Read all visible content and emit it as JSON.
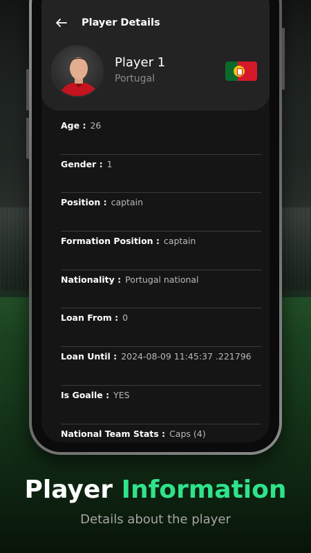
{
  "header": {
    "title": "Player Details",
    "player_name": "Player 1",
    "player_country": "Portugal"
  },
  "details": [
    {
      "label": "Age :",
      "value": "26"
    },
    {
      "label": "Gender :",
      "value": "1"
    },
    {
      "label": "Position :",
      "value": "captain"
    },
    {
      "label": "Formation Position :",
      "value": "captain"
    },
    {
      "label": "Nationality :",
      "value": "Portugal national"
    },
    {
      "label": "Loan From :",
      "value": "0"
    },
    {
      "label": "Loan Until :",
      "value": "2024-08-09 11:45:37 .221796"
    },
    {
      "label": "Is Goalle :",
      "value": "YES"
    },
    {
      "label": "National Team Stats :",
      "value": "Caps (4)"
    }
  ],
  "footer": {
    "caption_white": "Player",
    "caption_green": "Information",
    "subtitle": "Details about the player"
  },
  "colors": {
    "accent_green": "#2fe38b",
    "flag_green": "#0a6a2c",
    "flag_red": "#d6192a"
  }
}
